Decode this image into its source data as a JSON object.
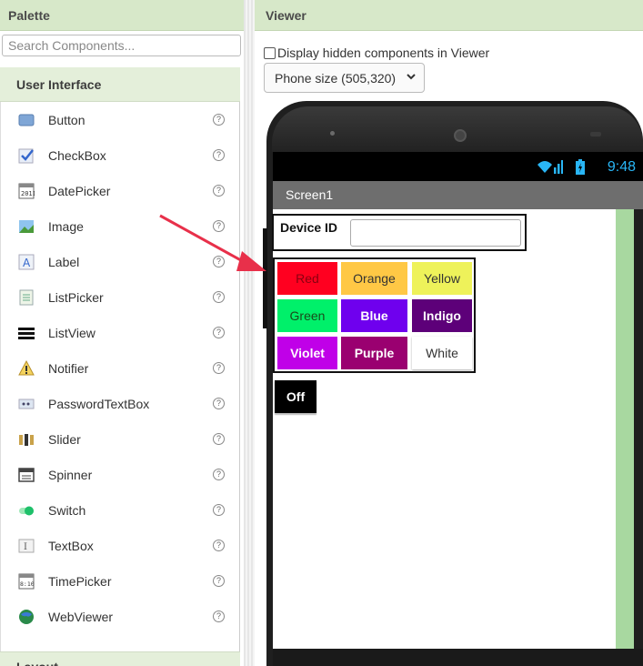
{
  "palette": {
    "title": "Palette",
    "search_placeholder": "Search Components...",
    "section": "User Interface",
    "items": [
      {
        "label": "Button",
        "icon": "button-icon"
      },
      {
        "label": "CheckBox",
        "icon": "checkbox-icon"
      },
      {
        "label": "DatePicker",
        "icon": "datepicker-icon"
      },
      {
        "label": "Image",
        "icon": "image-icon"
      },
      {
        "label": "Label",
        "icon": "label-icon"
      },
      {
        "label": "ListPicker",
        "icon": "listpicker-icon"
      },
      {
        "label": "ListView",
        "icon": "listview-icon"
      },
      {
        "label": "Notifier",
        "icon": "notifier-icon"
      },
      {
        "label": "PasswordTextBox",
        "icon": "password-icon"
      },
      {
        "label": "Slider",
        "icon": "slider-icon"
      },
      {
        "label": "Spinner",
        "icon": "spinner-icon"
      },
      {
        "label": "Switch",
        "icon": "switch-icon"
      },
      {
        "label": "TextBox",
        "icon": "textbox-icon"
      },
      {
        "label": "TimePicker",
        "icon": "timepicker-icon"
      },
      {
        "label": "WebViewer",
        "icon": "webviewer-icon"
      }
    ],
    "help_glyph": "?",
    "next_section": "Layout"
  },
  "viewer": {
    "title": "Viewer",
    "hidden_label": "Display hidden components in Viewer",
    "hidden_checked": false,
    "phone_size": "Phone size (505,320)",
    "status_time": "9:48",
    "screen_title": "Screen1",
    "device_id_label": "Device ID",
    "device_id_value": "",
    "color_buttons": [
      {
        "label": "Red",
        "bg": "#ff0020",
        "fg": "#8a0010"
      },
      {
        "label": "Orange",
        "bg": "#ffc845",
        "fg": "#333333"
      },
      {
        "label": "Yellow",
        "bg": "#eef25a",
        "fg": "#333333"
      },
      {
        "label": "Green",
        "bg": "#00f06a",
        "fg": "#1a4a1a"
      },
      {
        "label": "Blue",
        "bg": "#6f00ee",
        "fg": "#ffffff"
      },
      {
        "label": "Indigo",
        "bg": "#5d0079",
        "fg": "#ffffff"
      },
      {
        "label": "Violet",
        "bg": "#c000e8",
        "fg": "#ffffff"
      },
      {
        "label": "Purple",
        "bg": "#9a0070",
        "fg": "#ffffff"
      },
      {
        "label": "White",
        "bg": "#ffffff",
        "fg": "#333333"
      }
    ],
    "off_button": "Off"
  },
  "colors": {
    "header_bg": "#d7e8c9",
    "arrow": "#e8304a",
    "status_time": "#29b6f6"
  }
}
